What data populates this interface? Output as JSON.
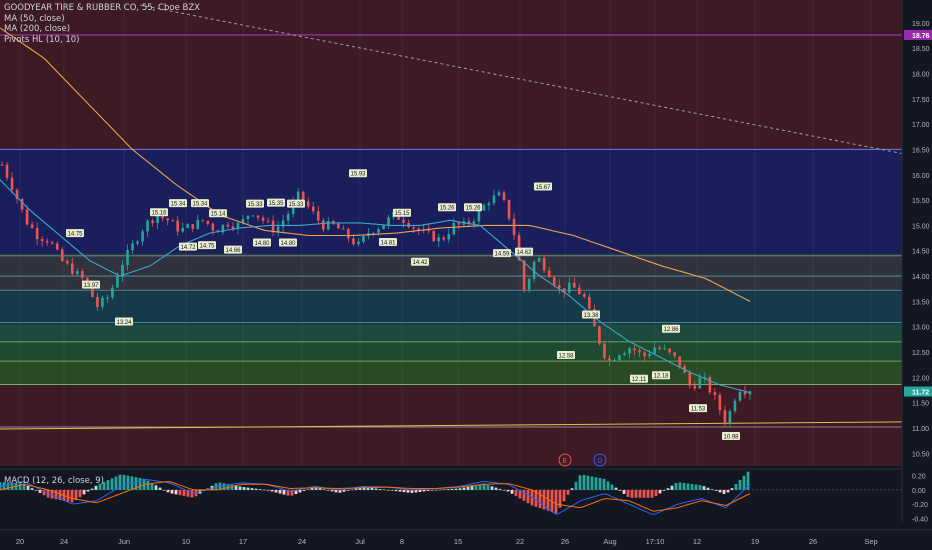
{
  "header": {
    "title": "GOODYEAR TIRE & RUBBER CO, 55, Cboe BZX",
    "indicators": [
      "MA (50, close)",
      "MA (200, close)",
      "Pivots HL (10, 10)"
    ]
  },
  "macd_panel": {
    "label": "MACD (12, 26, close, 9)",
    "axis_labels": [
      "0.20",
      "0.00",
      "-0.20",
      "-0.40"
    ]
  },
  "price_axis": {
    "tick_labels": [
      "19.00",
      "18.50",
      "18.00",
      "17.50",
      "17.00",
      "16.50",
      "16.00",
      "15.50",
      "15.00",
      "14.50",
      "14.00",
      "13.50",
      "13.00",
      "12.50",
      "12.00",
      "11.50",
      "11.00",
      "10.50"
    ],
    "badges": [
      {
        "text": "18.76",
        "price": 18.76,
        "color": "#9c27b0"
      },
      {
        "text": "11.72",
        "price": 11.72,
        "color": "#26a69a"
      }
    ]
  },
  "time_axis": {
    "labels": [
      "20",
      "24",
      "Jun",
      "10",
      "17",
      "24",
      "Jul",
      "8",
      "15",
      "22",
      "26",
      "Aug",
      "17:10",
      "12",
      "19",
      "26",
      "Sep"
    ]
  },
  "event_markers": [
    {
      "text": "E",
      "color": "#ef5350"
    },
    {
      "text": "D",
      "color": "#2962ff"
    }
  ],
  "colors": {
    "background": "#131722",
    "up": "#26a69a",
    "down": "#ef5350",
    "ma50": "#3aa8c8",
    "ma200": "#f0a050",
    "resistance_line": "#b040d0",
    "macd_line": "#2962ff",
    "signal_line": "#ff6d00"
  },
  "chart_data": {
    "type": "candlestick",
    "title": "GOODYEAR TIRE & RUBBER CO, 55, Cboe BZX",
    "ylim": [
      10.25,
      19.45
    ],
    "zones": [
      {
        "from": 16.5,
        "to": 19.45,
        "color": "maroon"
      },
      {
        "from": 14.45,
        "to": 16.5,
        "color": "navy"
      },
      {
        "from": 13.7,
        "to": 14.45,
        "color": "grey"
      },
      {
        "from": 13.05,
        "to": 13.7,
        "color": "teal"
      },
      {
        "from": 11.85,
        "to": 13.05,
        "color": "green"
      },
      {
        "from": 10.25,
        "to": 11.85,
        "color": "maroon"
      }
    ],
    "horizontal_levels": [
      18.76,
      14.4,
      14.0,
      13.72,
      13.08,
      12.7,
      12.32,
      11.86,
      11.02
    ],
    "trend_lines": [
      {
        "name": "descending resistance",
        "from_price": 19.35,
        "to_price": 16.42
      },
      {
        "name": "ascending support",
        "from_price": 10.98,
        "to_price": 11.12
      }
    ],
    "pivot_labels": [
      {
        "text": "14.75",
        "price": 14.75,
        "type": "high"
      },
      {
        "text": "13.97",
        "price": 13.97,
        "type": "low"
      },
      {
        "text": "13.24",
        "price": 13.24,
        "type": "low"
      },
      {
        "text": "15.16",
        "price": 15.16,
        "type": "high"
      },
      {
        "text": "15.34",
        "price": 15.34,
        "type": "high"
      },
      {
        "text": "14.72",
        "price": 14.72,
        "type": "low"
      },
      {
        "text": "15.34",
        "price": 15.34,
        "type": "high"
      },
      {
        "text": "14.75",
        "price": 14.75,
        "type": "low"
      },
      {
        "text": "15.14",
        "price": 15.14,
        "type": "high"
      },
      {
        "text": "14.66",
        "price": 14.66,
        "type": "low"
      },
      {
        "text": "15.33",
        "price": 15.33,
        "type": "high"
      },
      {
        "text": "14.80",
        "price": 14.8,
        "type": "low"
      },
      {
        "text": "15.35",
        "price": 15.35,
        "type": "high"
      },
      {
        "text": "14.80",
        "price": 14.8,
        "type": "low"
      },
      {
        "text": "15.33",
        "price": 15.33,
        "type": "high"
      },
      {
        "text": "15.93",
        "price": 15.93,
        "type": "high"
      },
      {
        "text": "14.81",
        "price": 14.81,
        "type": "low"
      },
      {
        "text": "15.15",
        "price": 15.15,
        "type": "high"
      },
      {
        "text": "14.42",
        "price": 14.42,
        "type": "low"
      },
      {
        "text": "15.26",
        "price": 15.26,
        "type": "high"
      },
      {
        "text": "15.26",
        "price": 15.26,
        "type": "high"
      },
      {
        "text": "14.59",
        "price": 14.59,
        "type": "low"
      },
      {
        "text": "14.62",
        "price": 14.62,
        "type": "low"
      },
      {
        "text": "15.67",
        "price": 15.67,
        "type": "high"
      },
      {
        "text": "12.58",
        "price": 12.58,
        "type": "low"
      },
      {
        "text": "13.38",
        "price": 13.38,
        "type": "low"
      },
      {
        "text": "12.86",
        "price": 12.86,
        "type": "high"
      },
      {
        "text": "12.11",
        "price": 12.11,
        "type": "low"
      },
      {
        "text": "12.18",
        "price": 12.18,
        "type": "low"
      },
      {
        "text": "11.53",
        "price": 11.53,
        "type": "low"
      },
      {
        "text": "10.98",
        "price": 10.98,
        "type": "low"
      }
    ],
    "close_anchors": [
      16.2,
      15.7,
      15.1,
      14.8,
      14.7,
      14.3,
      14.1,
      13.9,
      13.4,
      13.6,
      14.2,
      14.6,
      15.0,
      15.2,
      15.1,
      14.9,
      15.0,
      15.1,
      14.9,
      15.05,
      15.0,
      15.3,
      15.1,
      14.9,
      15.2,
      15.6,
      15.3,
      15.0,
      15.0,
      14.8,
      14.6,
      14.9,
      15.0,
      15.2,
      15.1,
      14.9,
      14.8,
      14.7,
      15.0,
      15.0,
      15.2,
      15.5,
      15.6,
      15.0,
      13.7,
      14.4,
      14.1,
      13.7,
      13.8,
      13.6,
      12.9,
      12.3,
      12.5,
      12.6,
      12.4,
      12.6,
      12.5,
      12.3,
      11.8,
      12.0,
      11.6,
      11.1,
      11.8,
      11.72
    ],
    "last_close": 11.72,
    "ma50_anchors": [
      15.9,
      15.3,
      14.8,
      14.3,
      14.0,
      14.2,
      14.6,
      14.85,
      14.95,
      15.0,
      15.0,
      15.05,
      15.05,
      15.0,
      15.0,
      15.1,
      15.0,
      14.5,
      14.0,
      13.6,
      13.1,
      12.7,
      12.4,
      12.1,
      11.85,
      11.7
    ],
    "ma200_anchors": [
      18.9,
      18.3,
      17.4,
      16.5,
      15.8,
      15.2,
      14.9,
      14.8,
      14.8,
      14.85,
      14.95,
      15.0,
      15.0,
      14.8,
      14.5,
      14.2,
      13.95,
      13.5
    ],
    "macd": {
      "ylim": [
        -0.45,
        0.28
      ],
      "macd_anchors": [
        0.05,
        0.12,
        -0.05,
        -0.2,
        -0.15,
        0.05,
        0.15,
        0.1,
        -0.05,
        0.05,
        0.1,
        0.08,
        -0.02,
        0.05,
        0.0,
        0.05,
        0.04,
        0.0,
        0.02,
        0.05,
        0.12,
        0.08,
        -0.1,
        -0.35,
        -0.15,
        -0.05,
        -0.2,
        -0.35,
        -0.2,
        -0.12,
        -0.25,
        0.08
      ],
      "signal_anchors": [
        0.0,
        0.08,
        0.0,
        -0.12,
        -0.18,
        -0.05,
        0.08,
        0.12,
        0.0,
        0.0,
        0.08,
        0.08,
        0.02,
        0.03,
        0.02,
        0.03,
        0.04,
        0.02,
        0.02,
        0.04,
        0.08,
        0.09,
        0.0,
        -0.2,
        -0.25,
        -0.12,
        -0.15,
        -0.3,
        -0.25,
        -0.15,
        -0.22,
        -0.05
      ]
    }
  }
}
